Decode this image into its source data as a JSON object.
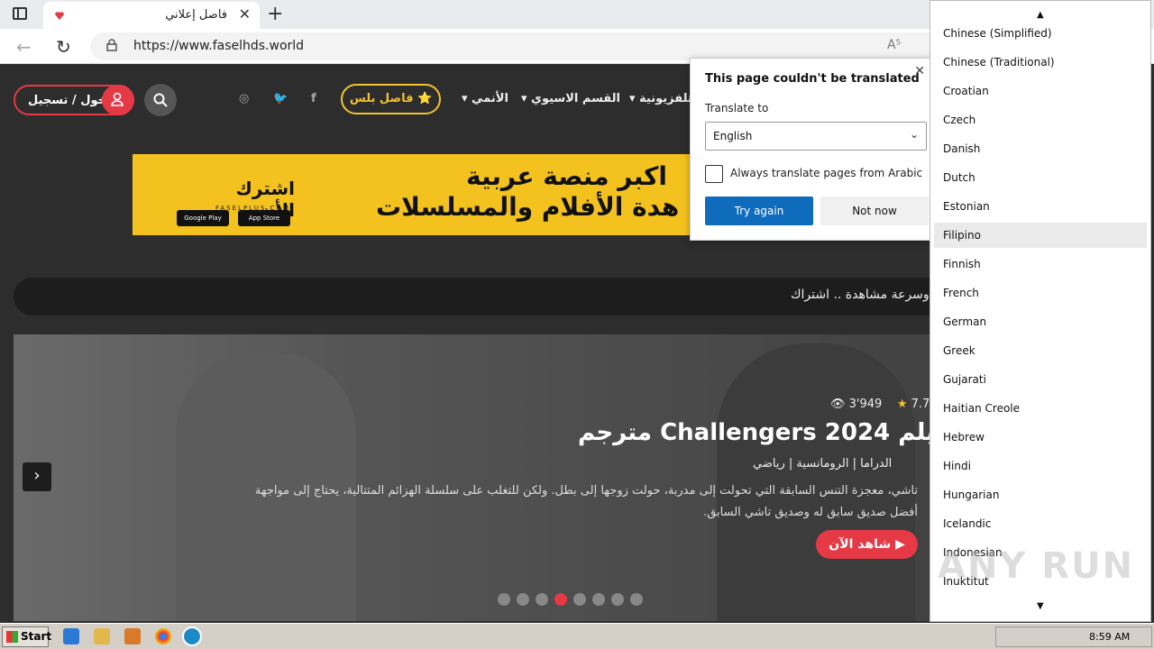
{
  "browser": {
    "tab_title": "فاصل إعلاني",
    "url": "https://www.faselhds.world",
    "reader_icon": "A⁵"
  },
  "header": {
    "login_label": "دخول / تسجيل",
    "plus_label": "⭐ فاصل بلس",
    "menu": [
      "الأنمي ▾",
      "القسم الاسيوي ▾",
      "التلفزيونية ▾"
    ]
  },
  "banner": {
    "subscribe": "اشترك الأن",
    "site": "FASELPLUS.COM",
    "google_play": "Google Play",
    "app_store": "App Store",
    "line1": "اكبر منصة عربية",
    "line2": "هدة الأفلام والمسلسلات"
  },
  "ticker": {
    "text": "وسرعة مشاهدة .. اشتراك"
  },
  "hero": {
    "rating": "7.7",
    "views": "3'949",
    "title": "فيلم Challengers 2024 مترجم",
    "genres": "الدراما  |  الرومانسية  |  رياضي",
    "description": "تاشي، معجزة التنس السابقة التي تحولت إلى مدربة، حولت زوجها إلى بطل. ولكن للتغلب على سلسلة الهزائم المتتالية، يحتاج إلى مواجهة أفضل صديق سابق له وصديق تاشي السابق.",
    "watch_label": "▶ شاهد الآن",
    "dot_count": 8,
    "active_dot": 3
  },
  "translate_popup": {
    "title": "This page couldn't be translated",
    "translate_to_label": "Translate to",
    "selected_language": "English",
    "always_label": "Always translate pages from Arabic",
    "try_again": "Try again",
    "not_now": "Not now"
  },
  "language_list": {
    "items": [
      "Chinese (Simplified)",
      "Chinese (Traditional)",
      "Croatian",
      "Czech",
      "Danish",
      "Dutch",
      "Estonian",
      "Filipino",
      "Finnish",
      "French",
      "German",
      "Greek",
      "Gujarati",
      "Haitian Creole",
      "Hebrew",
      "Hindi",
      "Hungarian",
      "Icelandic",
      "Indonesian",
      "Inuktitut"
    ],
    "highlighted_index": 7
  },
  "watermark": "ANY RUN",
  "taskbar": {
    "start_label": "Start",
    "clock": "8:59 AM"
  },
  "colors": {
    "accent_red": "#e53946",
    "gold": "#f2c230",
    "edge_blue": "#0f6cbd"
  }
}
